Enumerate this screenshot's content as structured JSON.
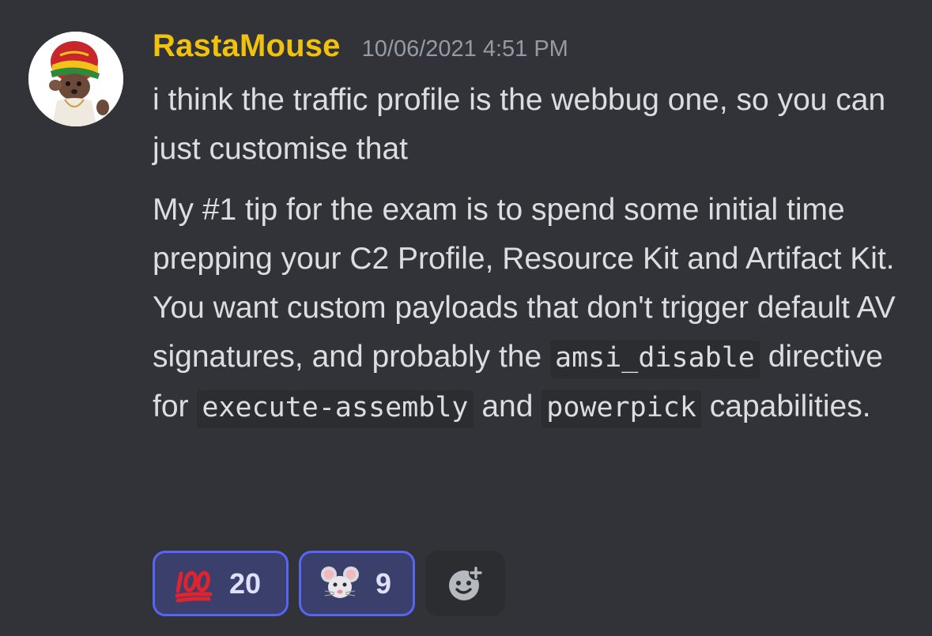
{
  "message": {
    "author": "RastaMouse",
    "timestamp": "10/06/2021 4:51 PM",
    "avatar_icon": "rasta-mouse-avatar",
    "username_color": "#f0c20f",
    "paragraphs": [
      {
        "segments": [
          {
            "type": "text",
            "text": "i think the traffic profile is the webbug one, so you can just customise that"
          }
        ]
      },
      {
        "segments": [
          {
            "type": "text",
            "text": "My #1 tip for the exam is to spend some initial time prepping your C2 Profile, Resource Kit and Artifact Kit.  You want custom payloads that don't trigger default AV signatures, and probably the "
          },
          {
            "type": "code",
            "text": "amsi_disable"
          },
          {
            "type": "text",
            "text": " directive for "
          },
          {
            "type": "code",
            "text": "execute-assembly"
          },
          {
            "type": "text",
            "text": " and "
          },
          {
            "type": "code",
            "text": "powerpick"
          },
          {
            "type": "text",
            "text": " capabilities."
          }
        ]
      }
    ]
  },
  "reactions": [
    {
      "emoji": "hundred-points-icon",
      "count": "20",
      "selected": true
    },
    {
      "emoji": "mouse-face-icon",
      "count": "9",
      "selected": true
    }
  ],
  "add_reaction": {
    "icon": "add-reaction-icon"
  },
  "colors": {
    "background": "#313338",
    "accent": "#5865f2",
    "text": "#dbdee1",
    "muted": "#949ba4"
  }
}
